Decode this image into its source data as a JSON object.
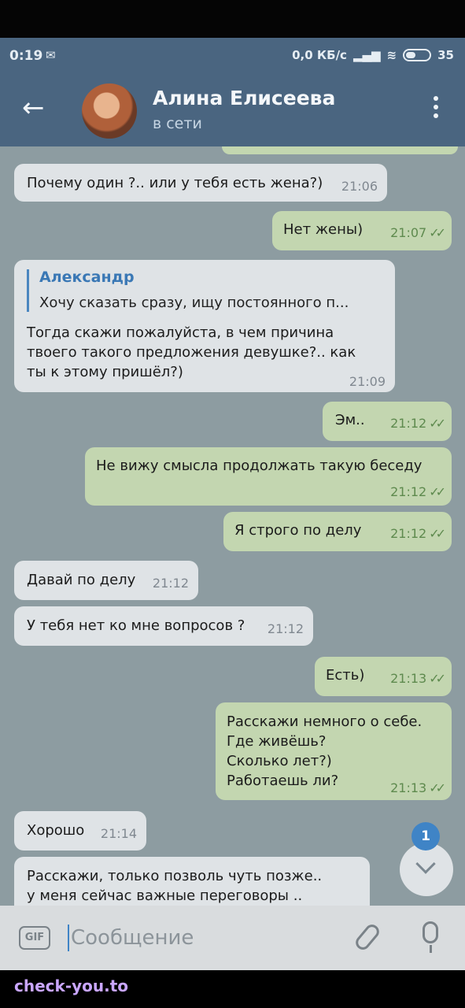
{
  "status_bar": {
    "time": "0:19",
    "speed": "0,0 КБ/с",
    "battery": "35"
  },
  "header": {
    "contact_name": "Алина Елисеева",
    "contact_status": "в сети"
  },
  "messages": [
    {
      "dir": "in",
      "text": "Почему один ?.. или у тебя есть жена?)",
      "time": "21:06"
    },
    {
      "dir": "out",
      "text": "Нет жены)",
      "time": "21:07"
    },
    {
      "dir": "in",
      "reply_name": "Александр",
      "reply_text": "Хочу сказать сразу, ищу постоянного п...",
      "text": "Тогда скажи пожалуйста, в чем причина\nтвоего такого предложения девушке?.. как\nты к этому пришёл?)",
      "time": "21:09"
    },
    {
      "dir": "out",
      "text": "Эм..",
      "time": "21:12"
    },
    {
      "dir": "out",
      "text": "Не вижу смысла продолжать такую беседу",
      "time": "21:12"
    },
    {
      "dir": "out",
      "text": "Я строго по делу",
      "time": "21:12"
    },
    {
      "dir": "in",
      "text": "Давай по делу",
      "time": "21:12"
    },
    {
      "dir": "in",
      "text": "У тебя нет ко мне вопросов ?",
      "time": "21:12"
    },
    {
      "dir": "out",
      "text": "Есть)",
      "time": "21:13"
    },
    {
      "dir": "out",
      "text": "Расскажи немного о себе.\nГде живёшь?\nСколько лет?)\nРаботаешь ли?",
      "time": "21:13"
    },
    {
      "dir": "in",
      "text": "Хорошо",
      "time": "21:14"
    },
    {
      "dir": "in",
      "text": "Расскажи, только позволь чуть позже..\nу меня сейчас важные переговоры .."
    }
  ],
  "scroll_badge": "1",
  "composer": {
    "gif_label": "GIF",
    "placeholder": "Сообщение"
  },
  "watermark": "check-you.to",
  "colors": {
    "header": "#4a6580",
    "incoming_bubble": "#dfe3e6",
    "outgoing_bubble": "#c3d6b0",
    "accent": "#3f84c6"
  },
  "icons": {
    "back": "arrow-left-icon",
    "menu": "more-vertical-icon",
    "attach": "paperclip-icon",
    "mic": "microphone-icon",
    "scroll": "chevron-down-icon"
  }
}
